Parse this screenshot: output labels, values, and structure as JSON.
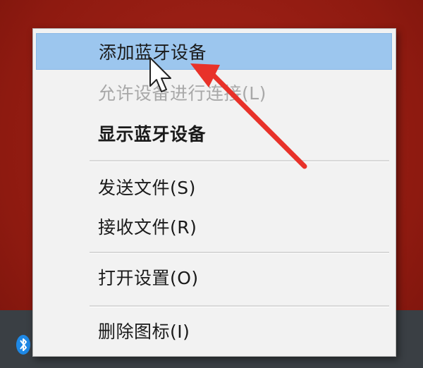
{
  "menu": {
    "items": [
      {
        "label": "添加蓝牙设备",
        "state": "hovered"
      },
      {
        "label": "允许设备进行连接(L)",
        "state": "disabled"
      },
      {
        "label": "显示蓝牙设备",
        "state": "default-bold"
      },
      {
        "label": "发送文件(S)",
        "state": "normal"
      },
      {
        "label": "接收文件(R)",
        "state": "normal"
      },
      {
        "label": "打开设置(O)",
        "state": "normal"
      },
      {
        "label": "删除图标(I)",
        "state": "normal"
      }
    ]
  },
  "icons": {
    "tray": "bluetooth-icon",
    "pointer": "mouse-cursor-icon",
    "annotation": "red-arrow-icon"
  },
  "colors": {
    "desktop": "#9c1c12",
    "menu_bg": "#f2f2f2",
    "highlight": "#9cc6ee",
    "disabled_text": "#a8a8a8",
    "annotation_arrow": "#e8322a",
    "bluetooth": "#1e88e5"
  }
}
